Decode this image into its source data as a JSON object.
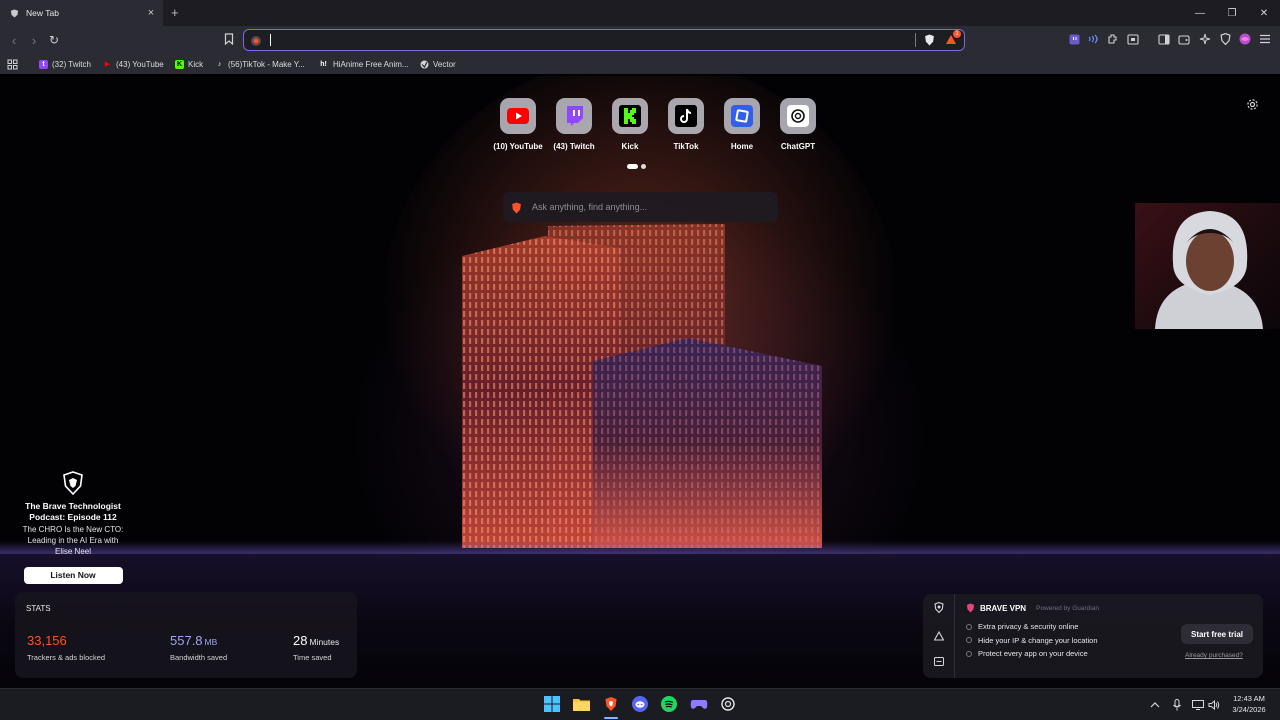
{
  "tab": {
    "title": "New Tab",
    "close": "×",
    "new_tab": "+"
  },
  "window": {
    "minimize": "—",
    "restore": "❐",
    "close": "✕"
  },
  "toolbar": {
    "back": "‹",
    "forward": "›",
    "reload": "↻",
    "address_value": "",
    "brave_shields_badge": "1"
  },
  "bookmarks": [
    {
      "label": "(32) Twitch",
      "icon": "twitch-icon",
      "color": "#9146ff",
      "glyph": "t"
    },
    {
      "label": "(43) YouTube",
      "icon": "youtube-icon",
      "color": "#ff0000",
      "glyph": "▶"
    },
    {
      "label": "Kick",
      "icon": "kick-icon",
      "color": "#53fc18",
      "glyph": "K"
    },
    {
      "label": "(56)TikTok - Make Y...",
      "icon": "tiktok-icon",
      "color": "#000000",
      "glyph": "♪"
    },
    {
      "label": "HiAnime Free Anim...",
      "icon": "hianime-icon",
      "color": "#2b2b33",
      "glyph": "h!"
    },
    {
      "label": "Vector",
      "icon": "vector-icon",
      "color": "#3a3a44",
      "glyph": "◎"
    }
  ],
  "top_sites": [
    {
      "label": "(10) YouTube",
      "icon": "youtube-icon"
    },
    {
      "label": "(43) Twitch",
      "icon": "twitch-icon"
    },
    {
      "label": "Kick",
      "icon": "kick-icon"
    },
    {
      "label": "TikTok",
      "icon": "tiktok-icon"
    },
    {
      "label": "Home",
      "icon": "home-icon"
    },
    {
      "label": "ChatGPT",
      "icon": "chatgpt-icon"
    }
  ],
  "search": {
    "placeholder": "Ask anything, find anything..."
  },
  "promo": {
    "title": "The Brave Technologist Podcast: Episode 112",
    "description": "The CHRO Is the New CTO: Leading in the AI Era with Elise Neel",
    "button": "Listen Now"
  },
  "stats": {
    "title": "STATS",
    "items": [
      {
        "value": "33,156",
        "unit": "",
        "label": "Trackers & ads blocked",
        "color": "#fb542b"
      },
      {
        "value": "557.8",
        "unit": "MB",
        "label": "Bandwidth saved",
        "color": "#a0a5eb"
      },
      {
        "value": "28",
        "unit": "Minutes",
        "label": "Time saved",
        "color": "#ffffff"
      }
    ]
  },
  "vpn": {
    "brand": "BRAVE VPN",
    "powered": "Powered by Guardian",
    "features": [
      "Extra privacy & security online",
      "Hide your IP & change your location",
      "Protect every app on your device"
    ],
    "trial_button": "Start free trial",
    "purchased_link": "Already purchased?"
  },
  "taskbar": {
    "apps": [
      "windows-start-icon",
      "file-explorer-icon",
      "brave-icon",
      "discord-icon",
      "spotify-icon",
      "game-controller-icon",
      "chatgpt-icon"
    ],
    "time": "12:43 AM",
    "date": "3/24/2026"
  },
  "colors": {
    "accent": "#7b6cd9",
    "brave_orange": "#fb542b",
    "background": "#000000"
  }
}
